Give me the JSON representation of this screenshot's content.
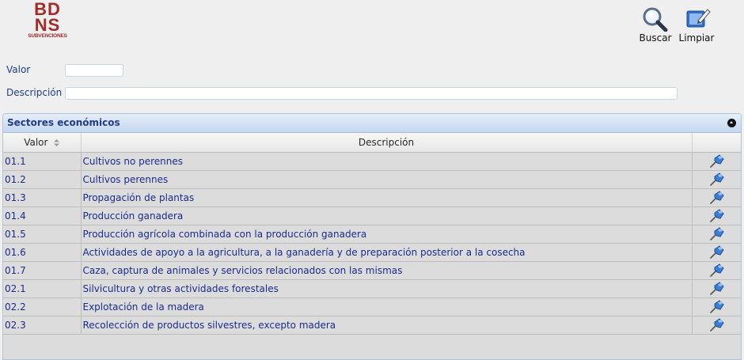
{
  "logo": {
    "line1": "BD",
    "line2": "NS",
    "line3": "SUBVENCIONES"
  },
  "toolbar": {
    "buscar_label": "Buscar",
    "limpiar_label": "Limpiar"
  },
  "form": {
    "valor_label": "Valor",
    "valor_value": "",
    "descripcion_label": "Descripción",
    "descripcion_value": ""
  },
  "panel": {
    "title": "Sectores económicos",
    "columns": {
      "valor": "Valor",
      "descripcion": "Descripción"
    },
    "rows": [
      {
        "valor": "01.1",
        "descripcion": "Cultivos no perennes"
      },
      {
        "valor": "01.2",
        "descripcion": "Cultivos perennes"
      },
      {
        "valor": "01.3",
        "descripcion": "Propagación de plantas"
      },
      {
        "valor": "01.4",
        "descripcion": "Producción ganadera"
      },
      {
        "valor": "01.5",
        "descripcion": "Producción agrícola combinada con la producción ganadera"
      },
      {
        "valor": "01.6",
        "descripcion": "Actividades de apoyo a la agricultura, a la ganadería y de preparación posterior a la cosecha"
      },
      {
        "valor": "01.7",
        "descripcion": "Caza, captura de animales y servicios relacionados con las mismas"
      },
      {
        "valor": "02.1",
        "descripcion": "Silvicultura y otras actividades forestales"
      },
      {
        "valor": "02.2",
        "descripcion": "Explotación de la madera"
      },
      {
        "valor": "02.3",
        "descripcion": "Recolección de productos silvestres, excepto madera"
      }
    ]
  },
  "icons": {
    "buscar": "magnifier-icon",
    "limpiar": "eraser-icon",
    "row_action": "pushpin-icon",
    "collapse": "collapse-up-icon",
    "sort": "sort-arrows-icon"
  },
  "colors": {
    "brand": "#a52a2a",
    "link_text": "#1a2c8c",
    "panel_header": "#c5d6ef"
  }
}
